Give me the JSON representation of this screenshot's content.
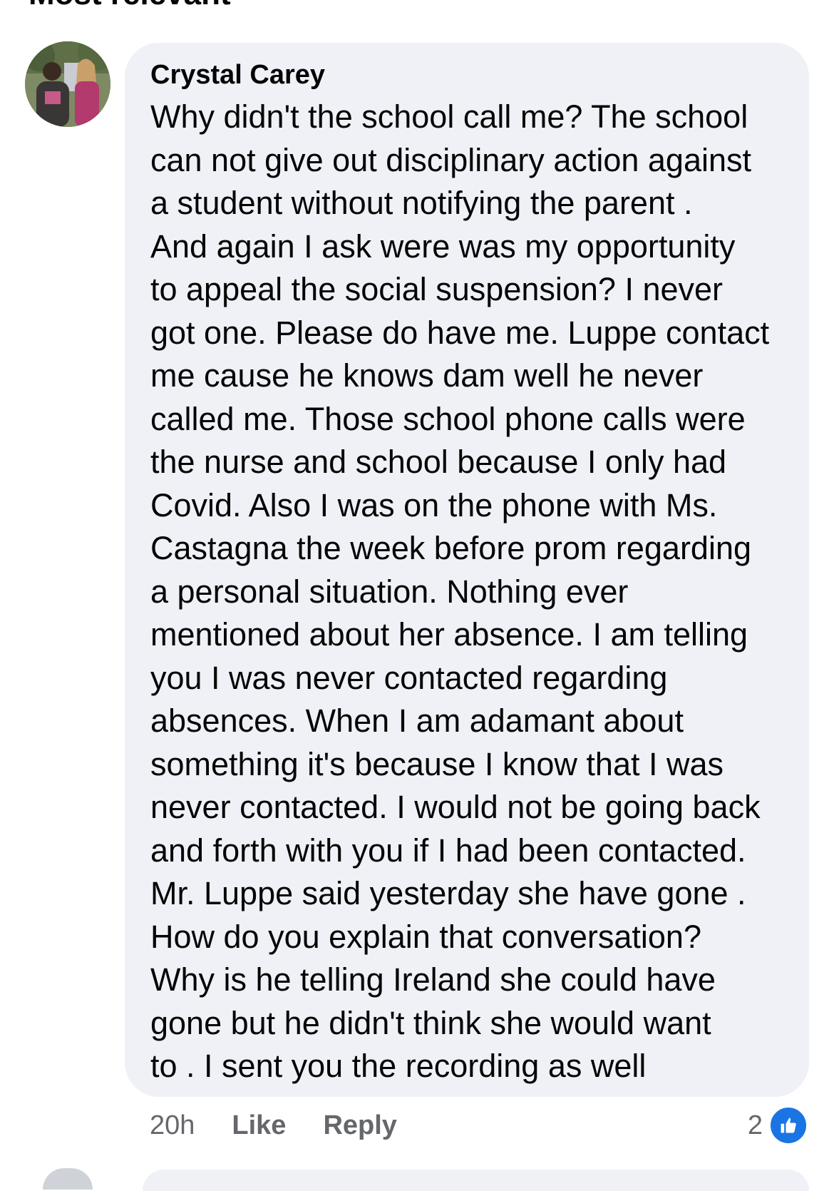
{
  "section": {
    "header": "Most relevant"
  },
  "comment": {
    "author": "Crystal Carey",
    "lines": [
      "Why didn't the school call me? The school",
      "can not give out disciplinary action against",
      "a student without notifying the parent .",
      "And again I ask were was my opportunity",
      "to appeal the social suspension? I never",
      "got one. Please do have me. Luppe contact",
      "me cause he knows dam well he never",
      "called me. Those school phone calls were",
      "the nurse and school because I only had",
      "Covid. Also I was on the phone with Ms.",
      "Castagna the week before prom regarding",
      "a personal situation. Nothing ever",
      "mentioned about her absence. I am telling",
      "you I was never contacted regarding",
      "absences. When I am adamant about",
      "something it's because I know that I was",
      "never contacted. I would not be going back",
      "and forth with you if I had been contacted.",
      "Mr. Luppe said yesterday she have gone .",
      "How do you explain that conversation?",
      "Why is he telling Ireland she could have",
      "gone but he didn't think she would want",
      "to . I sent you the recording as well"
    ],
    "time": "20h",
    "like_label": "Like",
    "reply_label": "Reply",
    "reaction_count": "2",
    "reaction_icon": "thumbs-up-icon"
  },
  "colors": {
    "bubble_bg": "#eff1f6",
    "meta_text": "#65676b",
    "like_blue": "#1b74e4"
  }
}
